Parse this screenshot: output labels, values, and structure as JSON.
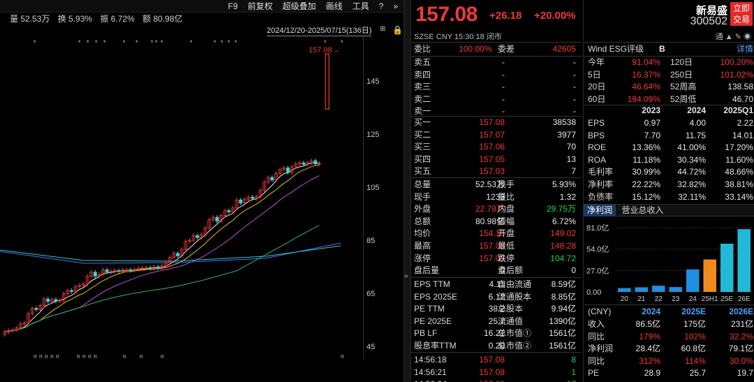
{
  "stats": {
    "volume": "量 52.53万",
    "turnover": "换 5.93%",
    "amplitude": "振 6.72%",
    "amount": "额 80.98亿"
  },
  "toolbar": {
    "f9": "F9",
    "fuquan": "前复权",
    "overlay": "超级叠加",
    "draw": "画线",
    "tools": "工具"
  },
  "date_range": "2024/12/20-2025/07/15(136日)",
  "price_label": "157.08",
  "y_ticks": [
    "145",
    "125",
    "105",
    "85",
    "65",
    "45"
  ],
  "quote": {
    "price": "157.08",
    "change": "+26.18",
    "change_pct": "+20.00%",
    "meta": "SZSE  CNY  15:30:18  闭市",
    "weibi_label": "委比",
    "weibi": "100.00%",
    "weicha_label": "委差",
    "weicha": "42605",
    "asks": [
      {
        "label": "卖五",
        "v": "-",
        "q": "-"
      },
      {
        "label": "卖四",
        "v": "-",
        "q": "-"
      },
      {
        "label": "卖三",
        "v": "-",
        "q": "-"
      },
      {
        "label": "卖二",
        "v": "-",
        "q": "-"
      },
      {
        "label": "卖一",
        "v": "-",
        "q": "-"
      }
    ],
    "bids": [
      {
        "label": "买一",
        "v": "157.08",
        "q": "38538"
      },
      {
        "label": "买二",
        "v": "157.07",
        "q": "3977"
      },
      {
        "label": "买三",
        "v": "157.06",
        "q": "70"
      },
      {
        "label": "买四",
        "v": "157.05",
        "q": "13"
      },
      {
        "label": "买五",
        "v": "157.03",
        "q": "7"
      }
    ],
    "details": [
      {
        "l1": "总量",
        "v1": "52.53万",
        "c1": "white",
        "l2": "换手",
        "v2": "5.93%",
        "c2": "white"
      },
      {
        "l1": "现手",
        "v1": "1233",
        "c1": "white",
        "l2": "量比",
        "v2": "1.32",
        "c2": "white"
      },
      {
        "l1": "外盘",
        "v1": "22.78万",
        "c1": "red",
        "l2": "内盘",
        "v2": "29.75万",
        "c2": "green"
      },
      {
        "l1": "总额",
        "v1": "80.98亿",
        "c1": "white",
        "l2": "振幅",
        "v2": "6.72%",
        "c2": "white"
      },
      {
        "l1": "均价",
        "v1": "154.15",
        "c1": "red",
        "l2": "开盘",
        "v2": "149.02",
        "c2": "red"
      },
      {
        "l1": "最高",
        "v1": "157.08",
        "c1": "red",
        "l2": "最低",
        "v2": "148.28",
        "c2": "red"
      },
      {
        "l1": "涨停",
        "v1": "157.08",
        "c1": "red",
        "l2": "跌停",
        "v2": "104.72",
        "c2": "green"
      },
      {
        "l1": "盘后量",
        "v1": "0",
        "c1": "white",
        "l2": "盘后额",
        "v2": "0",
        "c2": "white"
      }
    ],
    "valuation": [
      {
        "l1": "EPS TTM",
        "v1": "4.11",
        "l2": "自由流通",
        "v2": "8.59亿"
      },
      {
        "l1": "EPS 2025E",
        "v1": "6.12",
        "l2": "流通股本",
        "v2": "8.85亿"
      },
      {
        "l1": "PE TTM",
        "v1": "38.2",
        "l2": "总股本",
        "v2": "9.94亿"
      },
      {
        "l1": "PE 2025E",
        "v1": "25.7",
        "l2": "流通值",
        "v2": "1390亿"
      },
      {
        "l1": "PB LF",
        "v1": "16.21",
        "l2": "总市值①",
        "v2": "1561亿"
      },
      {
        "l1": "股息率TTM",
        "v1": "0.20",
        "l2": "总市值②",
        "v2": "1561亿"
      }
    ],
    "ticks": [
      {
        "t": "14:56:18",
        "p": "157.08",
        "q": "8"
      },
      {
        "t": "14:56:21",
        "p": "157.08",
        "q": "1"
      },
      {
        "t": "14:56:24",
        "p": "157.08",
        "q": "17"
      }
    ]
  },
  "funda": {
    "name": "新易盛",
    "code": "300502",
    "trade_btn": "立即交易",
    "trade_btn_l1": "立即",
    "trade_btn_l2": "交易",
    "icons": "通  ▲ ✎ ◉",
    "wind_label": "Wind  ESG评级",
    "esg": "B",
    "detail": "详情",
    "perf": [
      {
        "l1": "今年",
        "v1": "91.04%",
        "l2": "120日",
        "v2": "100.20%",
        "c2": "red"
      },
      {
        "l1": "5日",
        "v1": "16.37%",
        "l2": "250日",
        "v2": "101.02%",
        "c2": "red"
      },
      {
        "l1": "20日",
        "v1": "46.64%",
        "l2": "52周高",
        "v2": "138.58",
        "c2": "white"
      },
      {
        "l1": "60日",
        "v1": "194.09%",
        "l2": "52周低",
        "v2": "46.70",
        "c2": "white"
      }
    ],
    "years": [
      "2023",
      "2024",
      "2025Q1"
    ],
    "metrics": [
      {
        "l": "EPS",
        "a": "0.97",
        "b": "4.00",
        "c": "2.22"
      },
      {
        "l": "BPS",
        "a": "7.70",
        "b": "11.75",
        "c": "14.01"
      },
      {
        "l": "ROE",
        "a": "13.36%",
        "b": "41.00%",
        "c": "17.20%"
      },
      {
        "l": "ROA",
        "a": "11.18%",
        "b": "30.34%",
        "c": "11.60%"
      },
      {
        "l": "毛利率",
        "a": "30.99%",
        "b": "44.72%",
        "c": "48.66%"
      },
      {
        "l": "净利率",
        "a": "22.22%",
        "b": "32.82%",
        "c": "38.81%"
      },
      {
        "l": "负债率",
        "a": "15.12%",
        "b": "32.11%",
        "c": "33.14%"
      }
    ],
    "tabs": [
      "净利润",
      "营业总收入"
    ],
    "forecast_years": [
      "(CNY)",
      "2024",
      "2025E",
      "2026E"
    ],
    "forecast": [
      {
        "l": "收入",
        "a": "86.5亿",
        "b": "175亿",
        "c": "231亿",
        "color": "white"
      },
      {
        "l": "同比",
        "a": "179%",
        "b": "102%",
        "c": "32.2%",
        "color": "red"
      },
      {
        "l": "净利润",
        "a": "28.4亿",
        "b": "60.8亿",
        "c": "79.1亿",
        "color": "white"
      },
      {
        "l": "同比",
        "a": "312%",
        "b": "114%",
        "c": "30.0%",
        "color": "red"
      },
      {
        "l": "PE",
        "a": "28.9",
        "b": "25.7",
        "c": "19.7",
        "color": "white"
      }
    ]
  },
  "chart_data": {
    "type": "bar",
    "categories": [
      "20",
      "21",
      "22",
      "23",
      "24",
      "25H1",
      "25E",
      "26E"
    ],
    "values": [
      4.8,
      5.8,
      7.8,
      6.1,
      28.4,
      40.9,
      60.8,
      79.1
    ],
    "colors": [
      "#1f8fe0",
      "#1f8fe0",
      "#1f8fe0",
      "#1f8fe0",
      "#1f8fe0",
      "#f08a1c",
      "#24b8d8",
      "#24b8d8"
    ],
    "y_ticks": [
      "81.0亿",
      "54.0亿",
      "27.0亿",
      "0.00"
    ],
    "ylim": [
      0,
      81
    ]
  }
}
